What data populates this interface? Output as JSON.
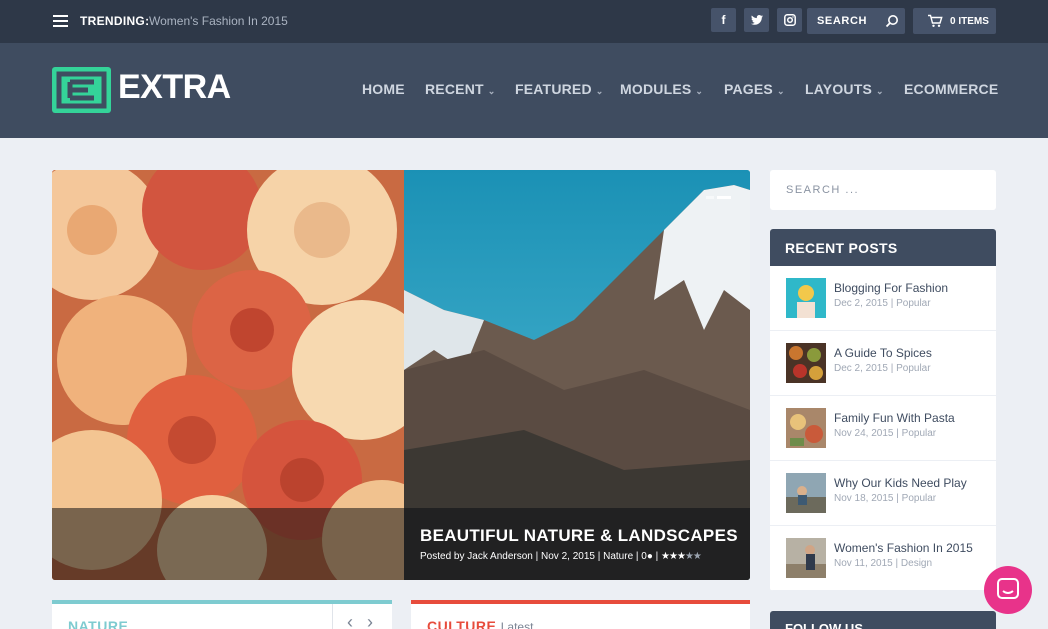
{
  "topbar": {
    "trending_label": "TRENDING:",
    "trending_text": "Women's Fashion In 2015",
    "social": [
      {
        "icon": "facebook-icon",
        "glyph": "f"
      },
      {
        "icon": "twitter-icon",
        "glyph": "t"
      },
      {
        "icon": "instagram-icon",
        "glyph": "◎"
      }
    ],
    "search_label": "SEARCH",
    "cart_label": "0 ITEMS"
  },
  "header": {
    "logo_text": "EXTRA",
    "nav": [
      {
        "label": "HOME",
        "dropdown": false
      },
      {
        "label": "RECENT",
        "dropdown": true
      },
      {
        "label": "FEATURED",
        "dropdown": true
      },
      {
        "label": "MODULES",
        "dropdown": true
      },
      {
        "label": "PAGES",
        "dropdown": true
      },
      {
        "label": "LAYOUTS",
        "dropdown": true
      },
      {
        "label": "ECOMMERCE",
        "dropdown": false
      }
    ]
  },
  "slider": {
    "title": "BEAUTIFUL NATURE & LANDSCAPES",
    "meta_posted": "Posted by Jack Anderson",
    "meta_date": "Nov 2, 2015",
    "meta_category": "Nature",
    "meta_comments": "0",
    "rating": 3,
    "rating_max": 5
  },
  "sidebar": {
    "search_placeholder": "SEARCH ...",
    "recent_heading": "RECENT POSTS",
    "posts": [
      {
        "title": "Blogging For Fashion",
        "date": "Dec 2, 2015",
        "tag": "Popular"
      },
      {
        "title": "A Guide To Spices",
        "date": "Dec 2, 2015",
        "tag": "Popular"
      },
      {
        "title": "Family Fun With Pasta",
        "date": "Nov 24, 2015",
        "tag": "Popular"
      },
      {
        "title": "Why Our Kids Need Play",
        "date": "Nov 18, 2015",
        "tag": "Popular"
      },
      {
        "title": "Women's Fashion In 2015",
        "date": "Nov 11, 2015",
        "tag": "Design"
      }
    ],
    "follow_heading": "FOLLOW US"
  },
  "cards": {
    "nature_title": "NATURE",
    "culture_title": "CULTURE",
    "culture_sub": "Latest"
  },
  "colors": {
    "topbar": "#2e3848",
    "header": "#3f4c60",
    "accent_green": "#34d399",
    "nature": "#7ecbd0",
    "culture": "#e74c3c",
    "chat": "#e8338a"
  }
}
